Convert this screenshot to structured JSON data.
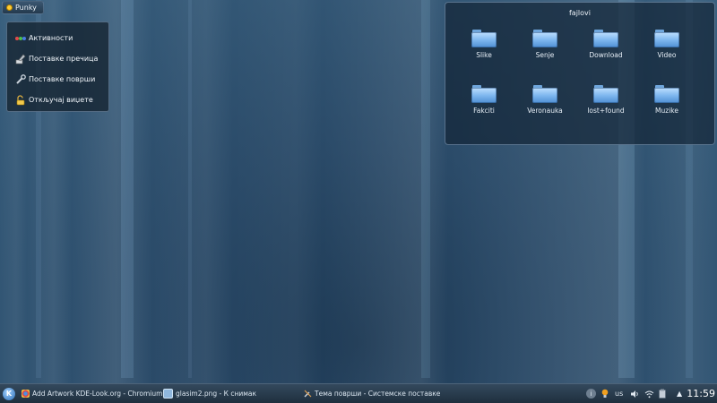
{
  "activity_button": {
    "label": "Punky"
  },
  "toolbox": {
    "items": [
      {
        "label": "Активности",
        "icon": "activities-icon"
      },
      {
        "label": "Поставке пречица",
        "icon": "shortcut-settings-icon"
      },
      {
        "label": "Поставке површи",
        "icon": "desktop-settings-icon"
      },
      {
        "label": "Откључај виџете",
        "icon": "unlock-widgets-icon"
      }
    ]
  },
  "folderview": {
    "title": "fajlovi",
    "folders": [
      {
        "label": "Slike"
      },
      {
        "label": "Senje"
      },
      {
        "label": "Download"
      },
      {
        "label": "Video"
      },
      {
        "label": "Fakciti"
      },
      {
        "label": "Veronauka"
      },
      {
        "label": "lost+found"
      },
      {
        "label": "Muzike"
      }
    ]
  },
  "taskbar": {
    "tasks": [
      {
        "label": "Add  Artwork KDE-Look.org - Chromium",
        "icon": "chromium-icon"
      },
      {
        "label": "glasim2.png - К снимак",
        "icon": "image-icon"
      },
      {
        "label": "Тема површи - Системске поставке",
        "icon": "system-settings-icon"
      }
    ],
    "tray": {
      "keyboard_layout": "us",
      "clock": "11:59"
    }
  },
  "colors": {
    "accent": "#7fb8ef",
    "panel_bg": "#1f2f3e"
  }
}
